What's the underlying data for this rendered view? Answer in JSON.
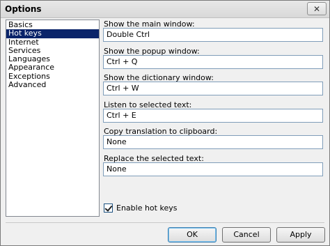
{
  "window": {
    "title": "Options",
    "close_glyph": "✕"
  },
  "sidebar": {
    "items": [
      {
        "label": "Basics"
      },
      {
        "label": "Hot keys",
        "selected": true
      },
      {
        "label": "Internet"
      },
      {
        "label": "Services"
      },
      {
        "label": "Languages"
      },
      {
        "label": "Appearance"
      },
      {
        "label": "Exceptions"
      },
      {
        "label": "Advanced"
      }
    ]
  },
  "hotkeys": {
    "fields": [
      {
        "label": "Show the main window:",
        "value": "Double Ctrl"
      },
      {
        "label": "Show the popup window:",
        "value": "Ctrl + Q"
      },
      {
        "label": "Show the dictionary window:",
        "value": "Ctrl + W"
      },
      {
        "label": "Listen to selected text:",
        "value": "Ctrl + E"
      },
      {
        "label": "Copy translation to clipboard:",
        "value": "None"
      },
      {
        "label": "Replace the selected text:",
        "value": "None"
      }
    ],
    "enable_label": "Enable hot keys",
    "enable_checked": true
  },
  "buttons": {
    "ok": "OK",
    "cancel": "Cancel",
    "apply": "Apply"
  },
  "colors": {
    "selection": "#0a246a",
    "input_border": "#7f9db9"
  }
}
